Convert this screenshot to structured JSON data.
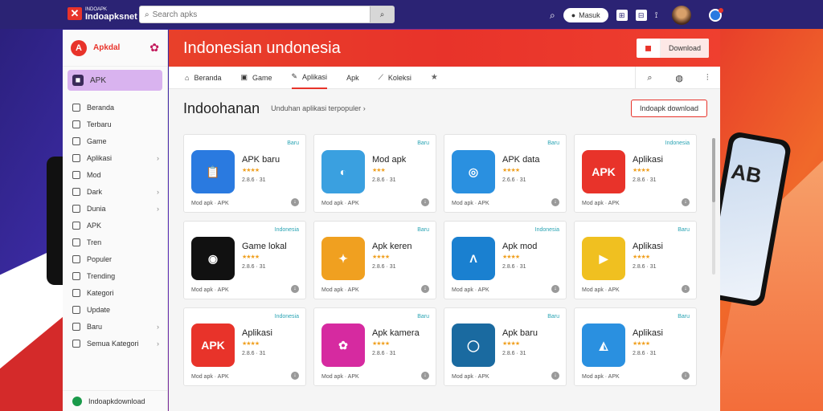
{
  "topbar": {
    "logo_small": "INDOAPK",
    "logo_text": "Indoapksnet",
    "search_placeholder": "Search apks",
    "login_label": "Masuk",
    "icon_labels": [
      "Q",
      "⊞",
      "⊟",
      "⟟"
    ]
  },
  "sidebar": {
    "header": "Apkdal",
    "active": "APK",
    "items": [
      {
        "label": "Beranda",
        "chevron": false
      },
      {
        "label": "Terbaru",
        "chevron": false
      },
      {
        "label": "Game",
        "chevron": false
      },
      {
        "label": "Aplikasi",
        "chevron": true
      },
      {
        "label": "Mod",
        "chevron": false
      },
      {
        "label": "Dark",
        "chevron": true
      },
      {
        "label": "Dunia",
        "chevron": true
      },
      {
        "label": "APK",
        "chevron": false
      },
      {
        "label": "Tren",
        "chevron": false
      },
      {
        "label": "Populer",
        "chevron": false
      },
      {
        "label": "Trending",
        "chevron": false
      },
      {
        "label": "Kategori",
        "chevron": false
      },
      {
        "label": "Update",
        "chevron": false
      },
      {
        "label": "Baru",
        "chevron": true
      },
      {
        "label": "Semua Kategori",
        "chevron": true
      }
    ],
    "footer": "Indoapkdownload"
  },
  "main": {
    "hero_title": "Indonesian undonesia",
    "hero_button": "Download",
    "tabs": [
      "Beranda",
      "Game",
      "Aplikasi",
      "Apk",
      "Koleksi"
    ],
    "active_tab": 2,
    "section_title": "Indoohanan",
    "breadcrumb": "Unduhan aplikasi terpopuler",
    "section_button": "Indoapk download"
  },
  "cards": [
    {
      "name": "APK baru",
      "stars": "★★★★",
      "meta": "2.8.6 · 31",
      "foot": "Mod apk · APK",
      "tag": "Baru",
      "color": "#2a7ae0",
      "icon": "📋"
    },
    {
      "name": "Mod apk",
      "stars": "★★★",
      "meta": "2.8.6 · 31",
      "foot": "Mod apk · APK",
      "tag": "Baru",
      "color": "#3aa0e0",
      "icon": "◐"
    },
    {
      "name": "APK data",
      "stars": "★★★★",
      "meta": "2.6.6 · 31",
      "foot": "Mod apk · APK",
      "tag": "Baru",
      "color": "#2a90e0",
      "icon": "◎"
    },
    {
      "name": "Aplikasi",
      "stars": "★★★★",
      "meta": "2.8.6 · 31",
      "foot": "Mod apk · APK",
      "tag": "Indonesia",
      "color": "#e8332a",
      "icon": "APK"
    },
    {
      "name": "Game lokal",
      "stars": "★★★★",
      "meta": "2.8.6 · 31",
      "foot": "Mod apk · APK",
      "tag": "Indonesia",
      "color": "#111111",
      "icon": "◉"
    },
    {
      "name": "Apk keren",
      "stars": "★★★★",
      "meta": "2.8.6 · 31",
      "foot": "Mod apk · APK",
      "tag": "Baru",
      "color": "#f0a020",
      "icon": "✦"
    },
    {
      "name": "Apk mod",
      "stars": "★★★★",
      "meta": "2.8.6 · 31",
      "foot": "Mod apk · APK",
      "tag": "Indonesia",
      "color": "#1a80d0",
      "icon": "Λ"
    },
    {
      "name": "Aplikasi",
      "stars": "★★★★",
      "meta": "2.8.6 · 31",
      "foot": "Mod apk · APK",
      "tag": "Baru",
      "color": "#f0c020",
      "icon": "▶"
    },
    {
      "name": "Aplikasi",
      "stars": "★★★★",
      "meta": "2.8.6 · 31",
      "foot": "Mod apk · APK",
      "tag": "Indonesia",
      "color": "#e8332a",
      "icon": "APK"
    },
    {
      "name": "Apk kamera",
      "stars": "★★★★",
      "meta": "2.8.6 · 31",
      "foot": "Mod apk · APK",
      "tag": "Baru",
      "color": "#d62aa0",
      "icon": "✿"
    },
    {
      "name": "Apk baru",
      "stars": "★★★★",
      "meta": "2.8.6 · 31",
      "foot": "Mod apk · APK",
      "tag": "Baru",
      "color": "#1a6aa0",
      "icon": "◯"
    },
    {
      "name": "Aplikasi",
      "stars": "★★★★",
      "meta": "2.8.6 · 31",
      "foot": "Mod apk · APK",
      "tag": "Baru",
      "color": "#2a90e0",
      "icon": "◭"
    }
  ]
}
